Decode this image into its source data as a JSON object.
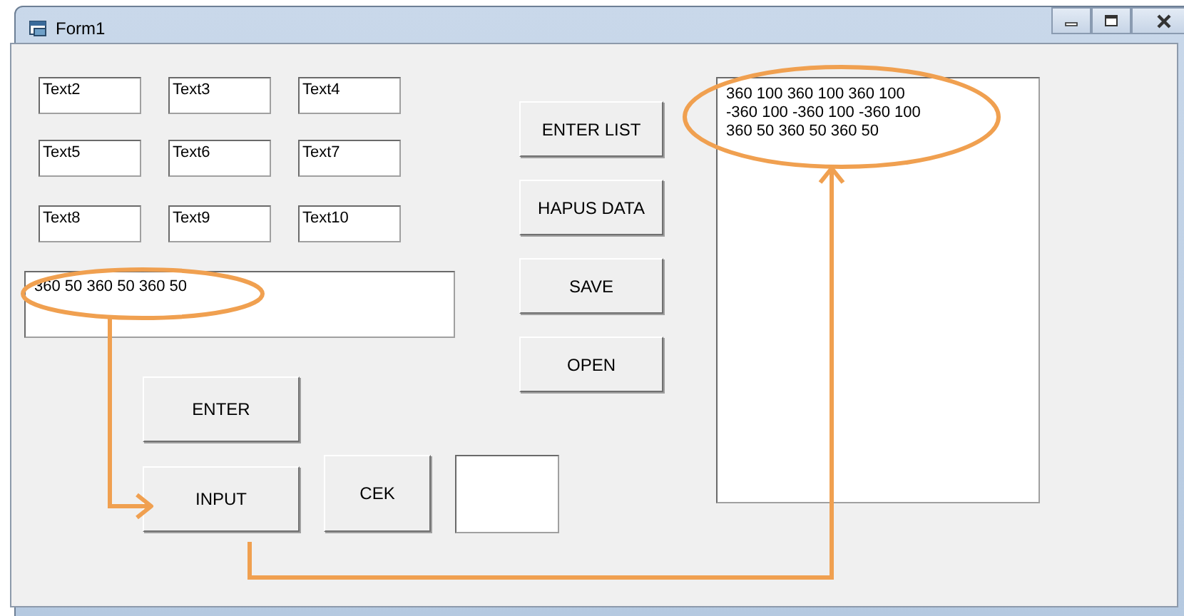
{
  "window": {
    "title": "Form1"
  },
  "text_boxes": [
    {
      "value": "Text2"
    },
    {
      "value": "Text3"
    },
    {
      "value": "Text4"
    },
    {
      "value": "Text5"
    },
    {
      "value": "Text6"
    },
    {
      "value": "Text7"
    },
    {
      "value": "Text8"
    },
    {
      "value": "Text9"
    },
    {
      "value": "Text10"
    }
  ],
  "input_box": {
    "value": "360 50 360 50 360 50"
  },
  "side_buttons": [
    "ENTER LIST",
    "HAPUS DATA",
    "SAVE",
    "OPEN"
  ],
  "bottom_buttons": [
    "ENTER",
    "INPUT",
    "CEK"
  ],
  "list_box": {
    "items": [
      "360 100 360 100 360 100",
      "-360 100 -360 100 -360 100",
      "360 50 360 50 360 50"
    ]
  }
}
